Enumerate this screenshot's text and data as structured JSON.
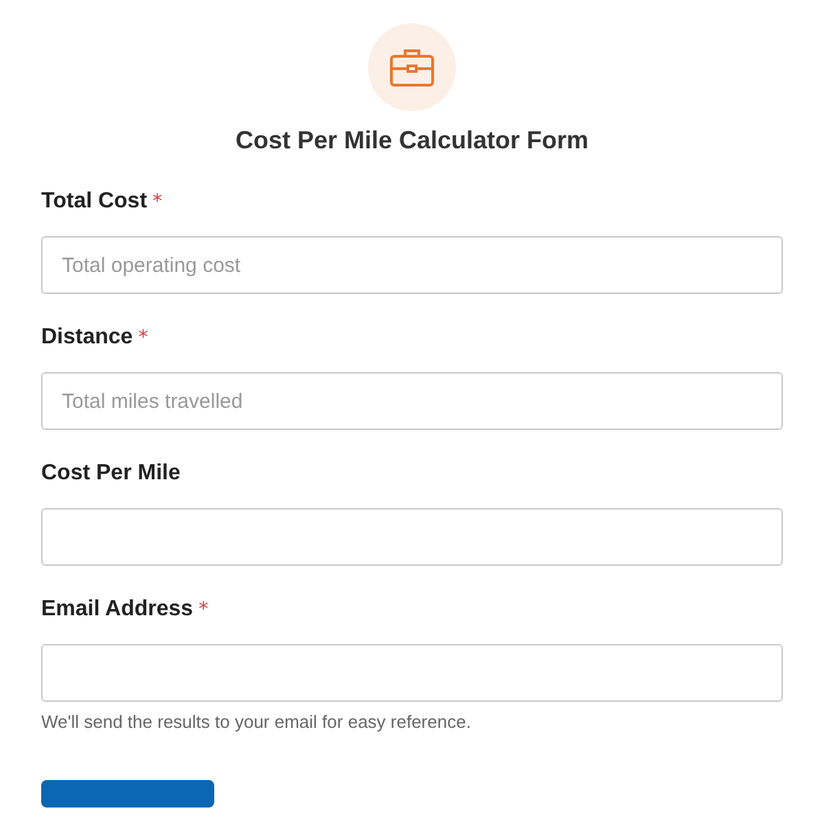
{
  "form": {
    "title": "Cost Per Mile Calculator Form",
    "fields": [
      {
        "label": "Total Cost",
        "required_mark": "*",
        "placeholder": "Total operating cost"
      },
      {
        "label": "Distance",
        "required_mark": "*",
        "placeholder": "Total miles travelled"
      },
      {
        "label": "Cost Per Mile"
      },
      {
        "label": "Email Address",
        "required_mark": "*",
        "help": "We'll send the results to your email for easy reference."
      }
    ]
  }
}
